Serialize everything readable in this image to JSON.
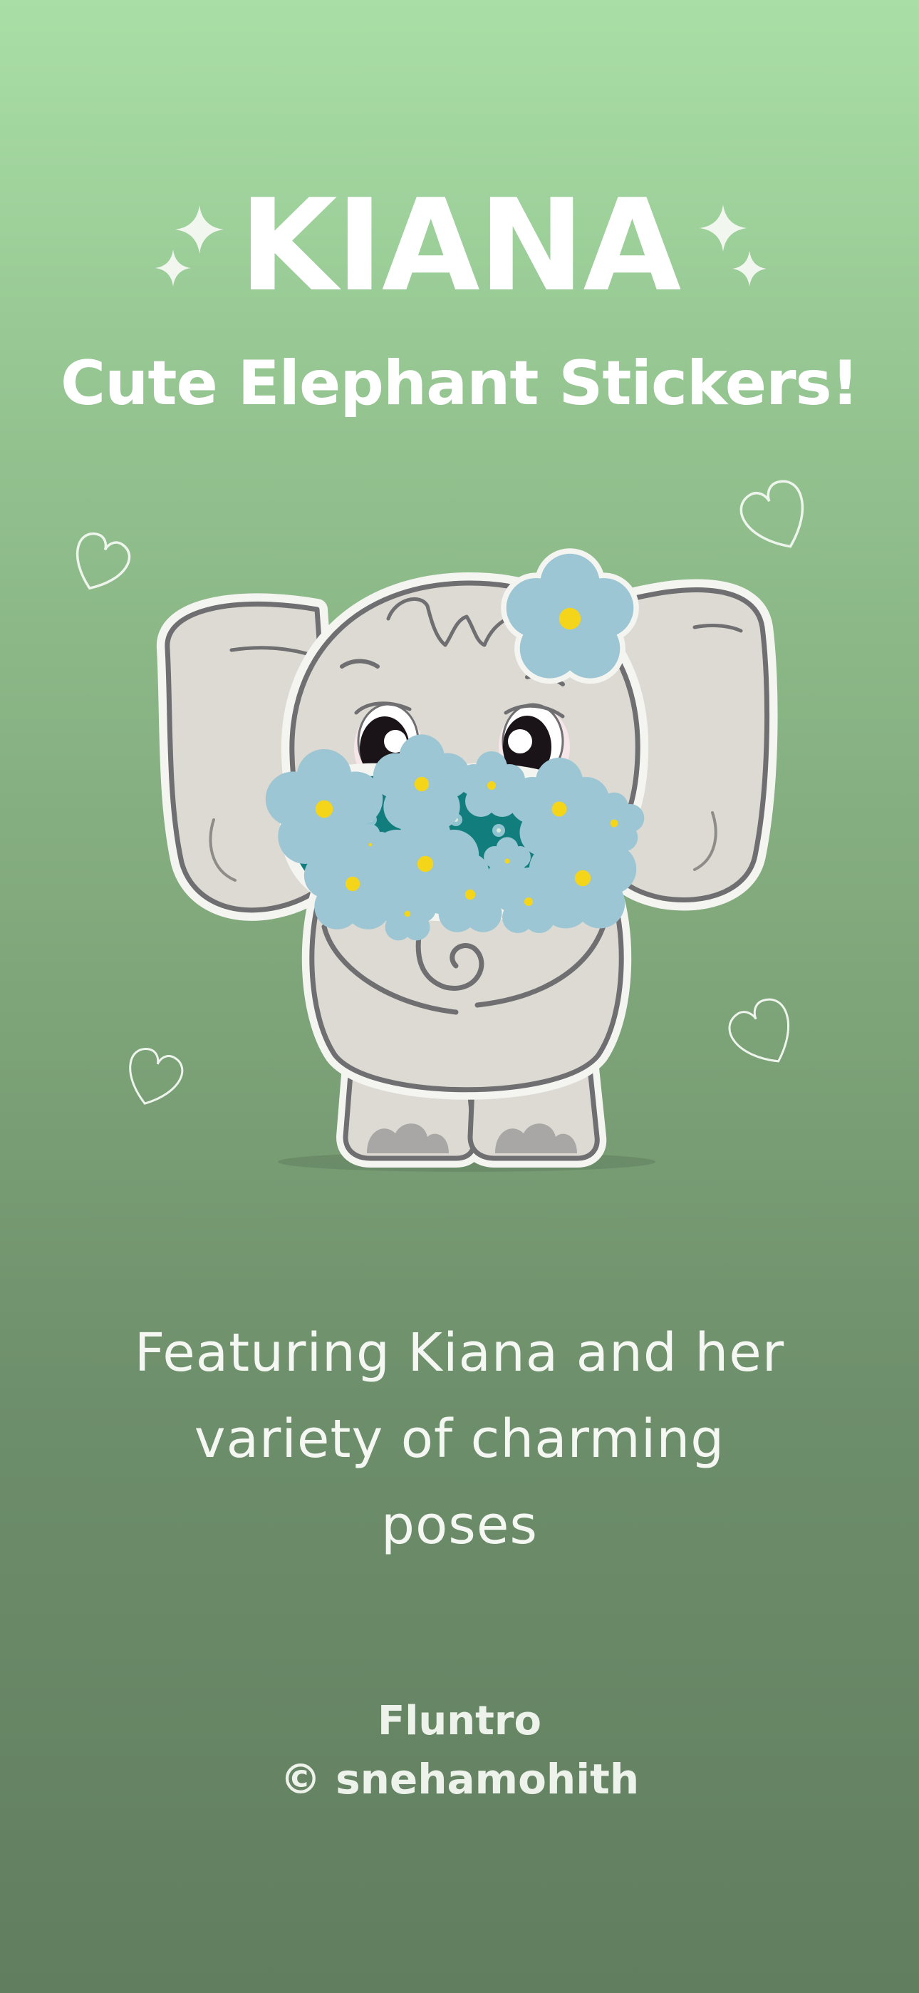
{
  "title": "KIANA",
  "subtitle": "Cute Elephant Stickers!",
  "description": "Featuring Kiana and her variety of charming poses",
  "brand": "Fluntro",
  "credit": "© snehamohith",
  "illustration": {
    "character": "elephant-with-flower-bouquet-icon",
    "decorations": [
      "sparkle-icon",
      "heart-icon"
    ]
  },
  "colors": {
    "background_top": "#a9dfa6",
    "background_bottom": "#617e5f",
    "text": "#ffffff",
    "flower_blue": "#9cc6d4",
    "flower_center": "#f5d51a",
    "bouquet_teal": "#117d7c",
    "elephant_body": "#dcdad2",
    "outline": "#6f6f72"
  }
}
